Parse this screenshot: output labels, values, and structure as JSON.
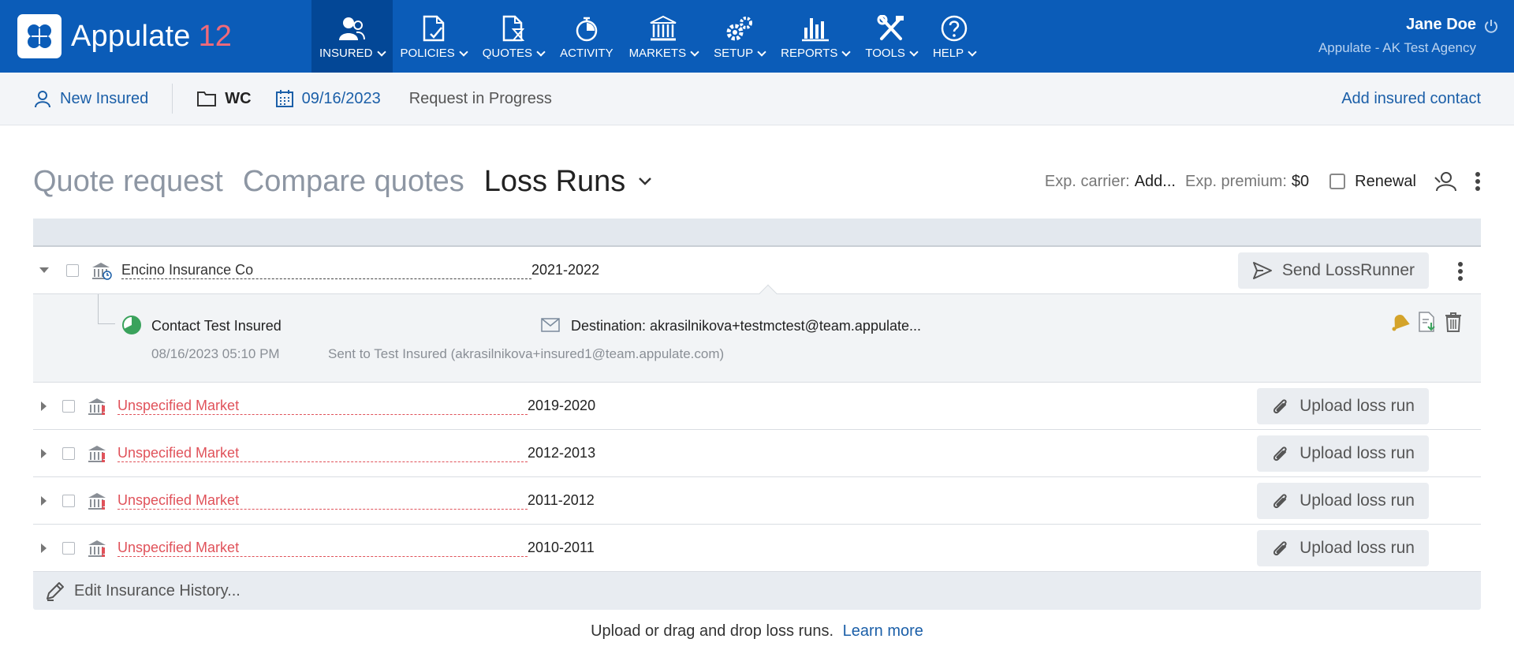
{
  "brand": {
    "name": "Appulate",
    "version": "12"
  },
  "nav": [
    {
      "label": "INSURED",
      "icon": "insured-icon",
      "active": true
    },
    {
      "label": "POLICIES",
      "icon": "policies-icon"
    },
    {
      "label": "QUOTES",
      "icon": "quotes-icon"
    },
    {
      "label": "ACTIVITY",
      "icon": "activity-icon"
    },
    {
      "label": "MARKETS",
      "icon": "markets-icon"
    },
    {
      "label": "SETUP",
      "icon": "setup-icon"
    },
    {
      "label": "REPORTS",
      "icon": "reports-icon"
    },
    {
      "label": "TOOLS",
      "icon": "tools-icon"
    },
    {
      "label": "HELP",
      "icon": "help-icon"
    }
  ],
  "user": {
    "name": "Jane Doe",
    "agency": "Appulate - AK Test Agency"
  },
  "subbar": {
    "insured": "New Insured",
    "lob": "WC",
    "date": "09/16/2023",
    "status": "Request in Progress",
    "add_contact": "Add insured contact"
  },
  "title": {
    "tab1": "Quote request",
    "tab2": "Compare quotes",
    "current": "Loss Runs",
    "exp_carrier_label": "Exp. carrier:",
    "exp_carrier_value": "Add...",
    "exp_premium_label": "Exp. premium:",
    "exp_premium_value": "$0",
    "renewal": "Renewal"
  },
  "rows": [
    {
      "carrier": "Encino Insurance Co",
      "period": "2021-2022",
      "action": "Send LossRunner",
      "warn": false
    },
    {
      "carrier": "Unspecified Market",
      "period": "2019-2020",
      "action": "Upload loss run",
      "warn": true
    },
    {
      "carrier": "Unspecified Market",
      "period": "2012-2013",
      "action": "Upload loss run",
      "warn": true
    },
    {
      "carrier": "Unspecified Market",
      "period": "2011-2012",
      "action": "Upload loss run",
      "warn": true
    },
    {
      "carrier": "Unspecified Market",
      "period": "2010-2011",
      "action": "Upload loss run",
      "warn": true
    }
  ],
  "detail": {
    "contact": "Contact Test Insured",
    "date": "08/16/2023 05:10 PM",
    "sent": "Sent to Test Insured (akrasilnikova+insured1@team.appulate.com)",
    "destination": "Destination: akrasilnikova+testmctest@team.appulate..."
  },
  "footer": {
    "edit_history": "Edit Insurance History...",
    "hint": "Upload or drag and drop loss runs.",
    "learn_more": "Learn more"
  },
  "colors": {
    "nav_bg": "#0b5cb8",
    "nav_active": "#034796",
    "link": "#1b5fa8",
    "warn": "#e0525a"
  }
}
